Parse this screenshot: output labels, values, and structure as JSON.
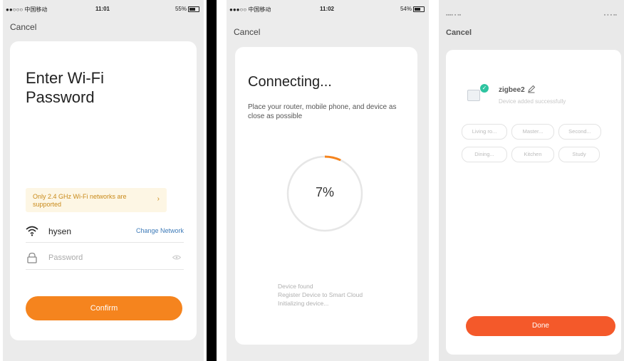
{
  "screen1": {
    "status": {
      "carrier": "●●○○○ 中国移动",
      "time": "11:01",
      "battery": "55%"
    },
    "cancel": "Cancel",
    "title": "Enter Wi-Fi Password",
    "notice": "Only 2.4 GHz Wi-Fi networks are supported",
    "network_name": "hysen",
    "change_network": "Change Network",
    "password_placeholder": "Password",
    "confirm": "Confirm"
  },
  "screen2": {
    "status": {
      "carrier": "●●●○○ 中国移动",
      "time": "11:02",
      "battery": "54%"
    },
    "cancel": "Cancel",
    "title": "Connecting...",
    "subtitle": "Place your router, mobile phone, and device as close as possible",
    "progress_label": "7%",
    "progress": 0.07,
    "steps": [
      "Device found",
      "Register Device to Smart Cloud",
      "Initializing device..."
    ]
  },
  "screen3": {
    "cancel": "Cancel",
    "device_name": "zigbee2",
    "device_status": "Device added successfully",
    "rooms": [
      "Living ro...",
      "Master...",
      "Second...",
      "Dining...",
      "Kitchen",
      "Study"
    ],
    "done": "Done"
  },
  "colors": {
    "accent_orange": "#f5841e",
    "done_red": "#f4592a",
    "success_green": "#2ec4a0",
    "link_blue": "#3d7ab8",
    "notice_text": "#c98a1a"
  }
}
